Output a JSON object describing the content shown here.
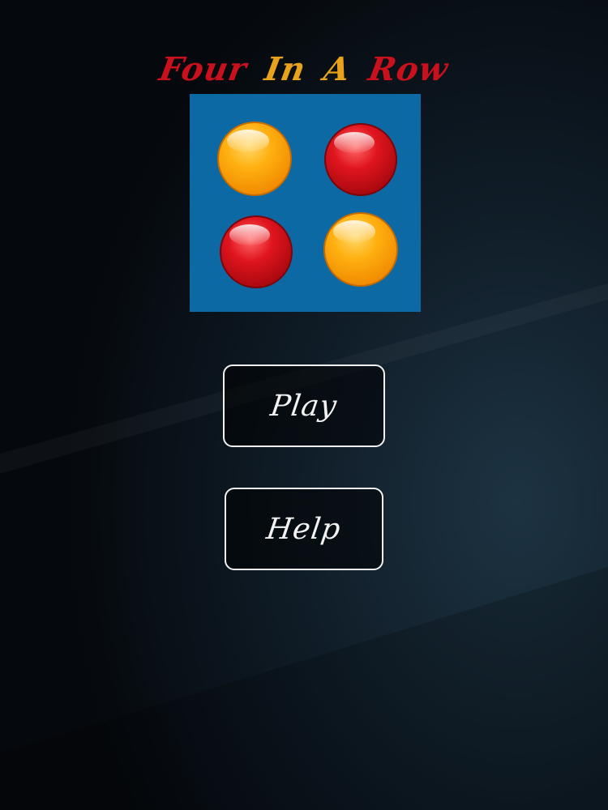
{
  "app": {
    "title_words": [
      {
        "text": "Four",
        "color": "#c8111c"
      },
      {
        "text": "In",
        "color": "#e8a21c"
      },
      {
        "text": "A",
        "color": "#e8a21c"
      },
      {
        "text": "Row",
        "color": "#c8111c"
      }
    ]
  },
  "logo": {
    "panel_color": "#0d69a3",
    "pieces": [
      {
        "name": "orange-disc-icon",
        "color": "orange"
      },
      {
        "name": "red-disc-icon",
        "color": "red"
      },
      {
        "name": "red-disc-icon",
        "color": "red"
      },
      {
        "name": "orange-disc-icon",
        "color": "orange"
      }
    ]
  },
  "menu": {
    "play_label": "Play",
    "help_label": "Help"
  },
  "colors": {
    "background": "#0b1219",
    "button_border": "#f2f2f2",
    "orange_piece": "#ffa500",
    "red_piece": "#d0101a"
  }
}
